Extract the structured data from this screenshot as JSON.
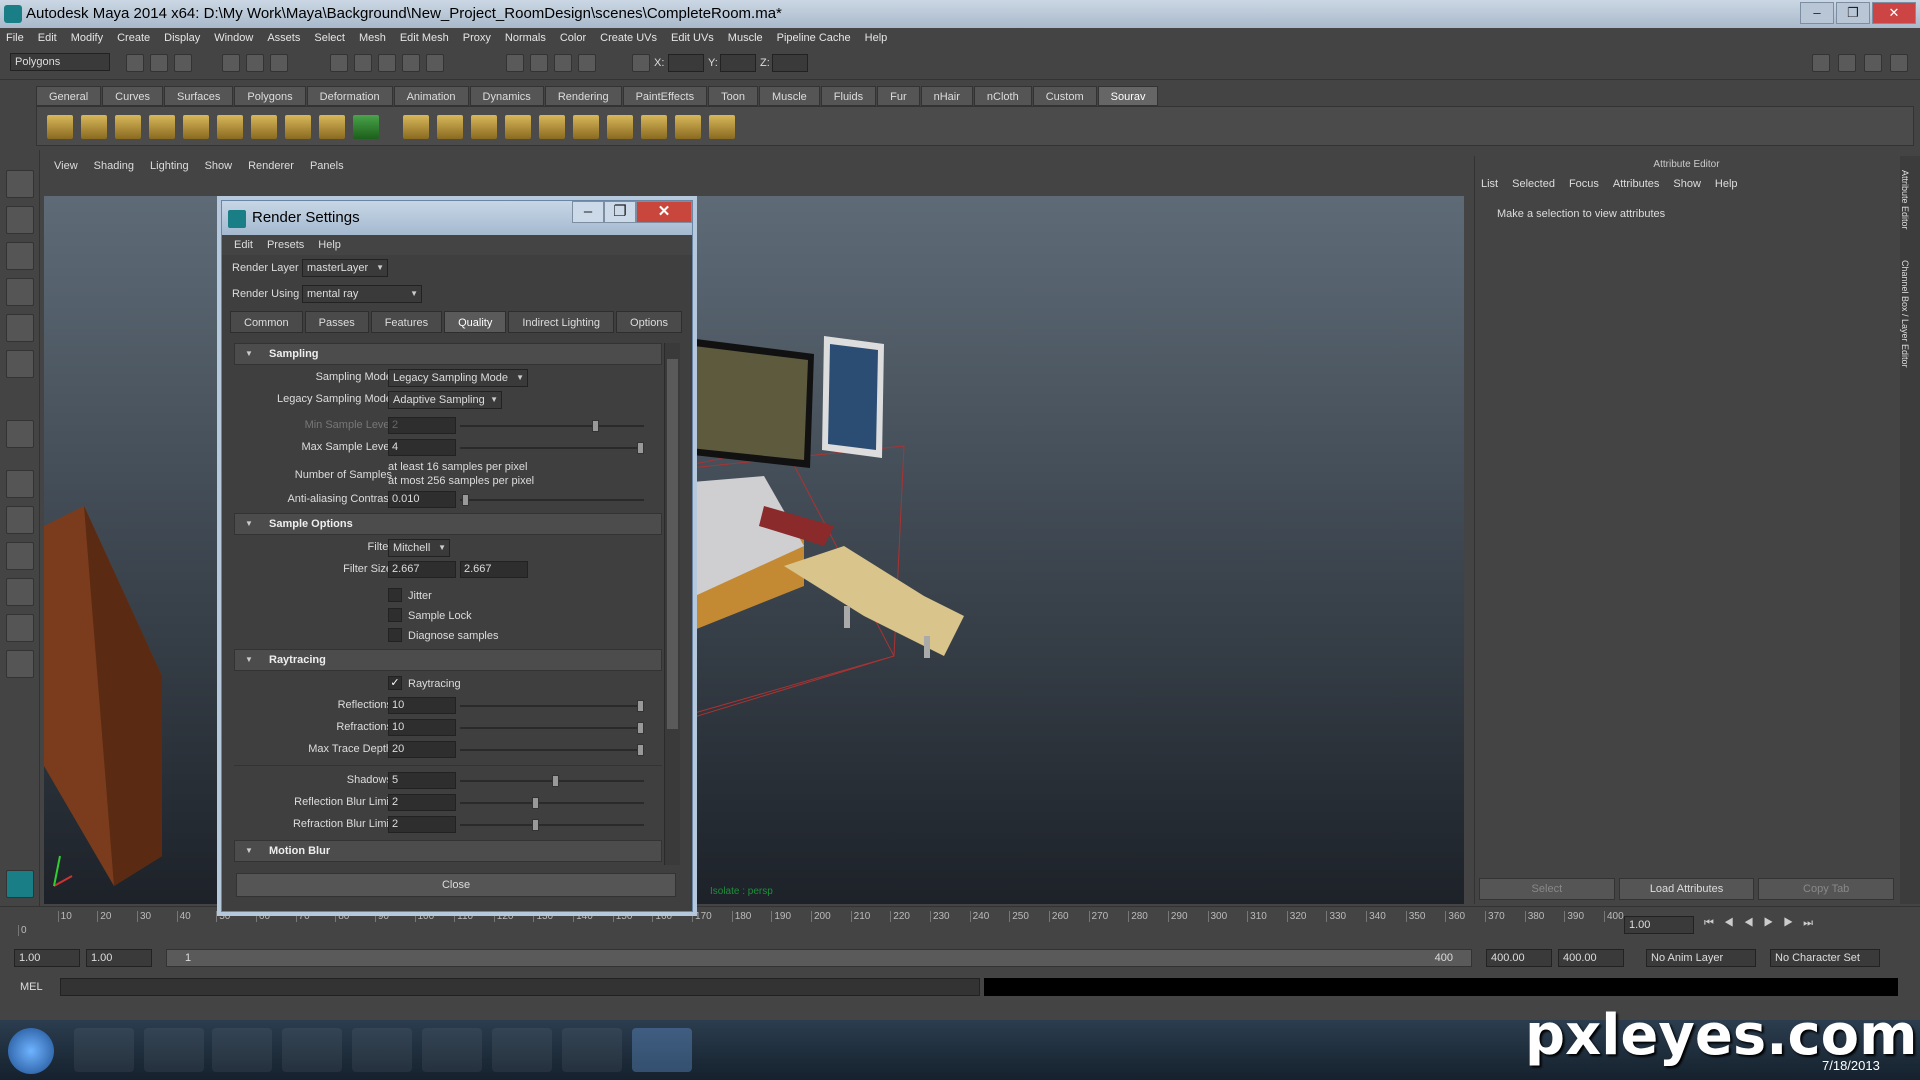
{
  "window": {
    "title": "Autodesk Maya 2014 x64: D:\\My Work\\Maya\\Background\\New_Project_RoomDesign\\scenes\\CompleteRoom.ma*"
  },
  "menubar": [
    "File",
    "Edit",
    "Modify",
    "Create",
    "Display",
    "Window",
    "Assets",
    "Select",
    "Mesh",
    "Edit Mesh",
    "Proxy",
    "Normals",
    "Color",
    "Create UVs",
    "Edit UVs",
    "Muscle",
    "Pipeline Cache",
    "Help"
  ],
  "status": {
    "menuset": "Polygons",
    "x_label": "X:",
    "y_label": "Y:",
    "z_label": "Z:"
  },
  "shelf_tabs": [
    "General",
    "Curves",
    "Surfaces",
    "Polygons",
    "Deformation",
    "Animation",
    "Dynamics",
    "Rendering",
    "PaintEffects",
    "Toon",
    "Muscle",
    "Fluids",
    "Fur",
    "nHair",
    "nCloth",
    "Custom",
    "Sourav"
  ],
  "panel_menu": [
    "View",
    "Shading",
    "Lighting",
    "Show",
    "Renderer",
    "Panels"
  ],
  "viewport": {
    "hud": "Isolate : persp"
  },
  "attribute_editor": {
    "title": "Attribute Editor",
    "menu": [
      "List",
      "Selected",
      "Focus",
      "Attributes",
      "Show",
      "Help"
    ],
    "message": "Make a selection to view attributes",
    "buttons": {
      "select": "Select",
      "load": "Load Attributes",
      "copy": "Copy Tab"
    },
    "side_tabs": [
      "Attribute Editor",
      "Channel Box / Layer Editor"
    ]
  },
  "render_settings": {
    "title": "Render Settings",
    "menu": [
      "Edit",
      "Presets",
      "Help"
    ],
    "render_layer_label": "Render Layer",
    "render_layer": "masterLayer",
    "render_using_label": "Render Using",
    "render_using": "mental ray",
    "tabs": [
      "Common",
      "Passes",
      "Features",
      "Quality",
      "Indirect Lighting",
      "Options"
    ],
    "sampling": {
      "header": "Sampling",
      "mode_label": "Sampling Mode",
      "mode": "Legacy Sampling Mode",
      "legacy_label": "Legacy Sampling Mode",
      "legacy": "Adaptive Sampling",
      "min_label": "Min Sample Level",
      "min": "2",
      "max_label": "Max Sample Level",
      "max": "4",
      "num_label": "Number of Samples",
      "num_line1": "at least 16 samples per pixel",
      "num_line2": "at most 256 samples per pixel",
      "aa_label": "Anti-aliasing Contrast",
      "aa": "0.010"
    },
    "sample_options": {
      "header": "Sample Options",
      "filter_label": "Filter",
      "filter": "Mitchell",
      "size_label": "Filter Size",
      "size_x": "2.667",
      "size_y": "2.667",
      "jitter": "Jitter",
      "lock": "Sample Lock",
      "diagnose": "Diagnose samples"
    },
    "raytracing": {
      "header": "Raytracing",
      "enable": "Raytracing",
      "check": "✓",
      "refl_label": "Reflections",
      "refl": "10",
      "refr_label": "Refractions",
      "refr": "10",
      "depth_label": "Max Trace Depth",
      "depth": "20",
      "shadows_label": "Shadows",
      "shadows": "5",
      "rbl_label": "Reflection Blur Limit",
      "rbl": "2",
      "fbl_label": "Refraction Blur Limit",
      "fbl": "2"
    },
    "motion_blur": {
      "header": "Motion Blur"
    },
    "close": "Close"
  },
  "timeline": {
    "ticks": [
      "0",
      "10",
      "20",
      "30",
      "40",
      "50",
      "60",
      "70",
      "80",
      "90",
      "100",
      "110",
      "120",
      "130",
      "140",
      "150",
      "160",
      "170",
      "180",
      "190",
      "200",
      "210",
      "220",
      "230",
      "240",
      "250",
      "260",
      "270",
      "280",
      "290",
      "300",
      "310",
      "320",
      "330",
      "340",
      "350",
      "360",
      "370",
      "380",
      "390",
      "400"
    ],
    "current": "1.00"
  },
  "range": {
    "start": "1.00",
    "start2": "1.00",
    "frame": "1",
    "end_label": "400",
    "end": "400.00",
    "end2": "400.00",
    "anim_layer": "No Anim Layer",
    "char_set": "No Character Set"
  },
  "cmdline": {
    "label": "MEL"
  },
  "taskbar": {
    "date": "7/18/2013"
  },
  "watermark": "pxleyes.com"
}
